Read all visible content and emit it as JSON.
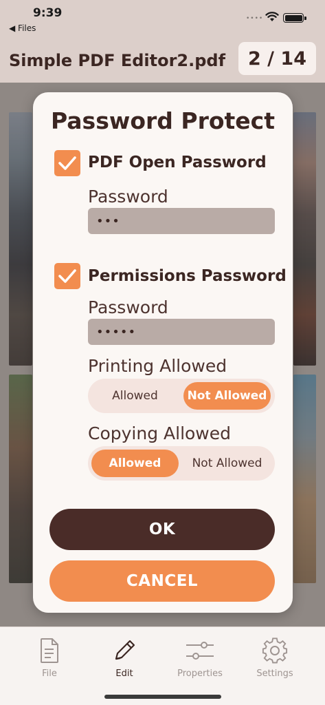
{
  "status_bar": {
    "time": "9:39",
    "back_label": "◀ Files"
  },
  "navbar": {
    "document_title": "Simple PDF Editor2.pdf",
    "page_counter": "2 / 14"
  },
  "dialog": {
    "title": "Password Protect",
    "open_password": {
      "checkbox_label": "PDF Open Password",
      "checked": true,
      "field_label": "Password",
      "value": "•••"
    },
    "permissions_password": {
      "checkbox_label": "Permissions Password",
      "checked": true,
      "field_label": "Password",
      "value": "•••••"
    },
    "printing": {
      "label": "Printing Allowed",
      "options": [
        "Allowed",
        "Not Allowed"
      ],
      "selected": "Not Allowed"
    },
    "copying": {
      "label": "Copying Allowed",
      "options": [
        "Allowed",
        "Not Allowed"
      ],
      "selected": "Allowed"
    },
    "ok_label": "OK",
    "cancel_label": "CANCEL"
  },
  "tabbar": {
    "items": [
      {
        "label": "File",
        "icon": "file-icon",
        "active": false
      },
      {
        "label": "Edit",
        "icon": "pencil-icon",
        "active": true
      },
      {
        "label": "Properties",
        "icon": "sliders-icon",
        "active": false
      },
      {
        "label": "Settings",
        "icon": "gear-icon",
        "active": false
      }
    ]
  },
  "colors": {
    "accent": "#f28d4f",
    "primary_dark": "#4a2c28",
    "header_bg": "#dccfca"
  }
}
